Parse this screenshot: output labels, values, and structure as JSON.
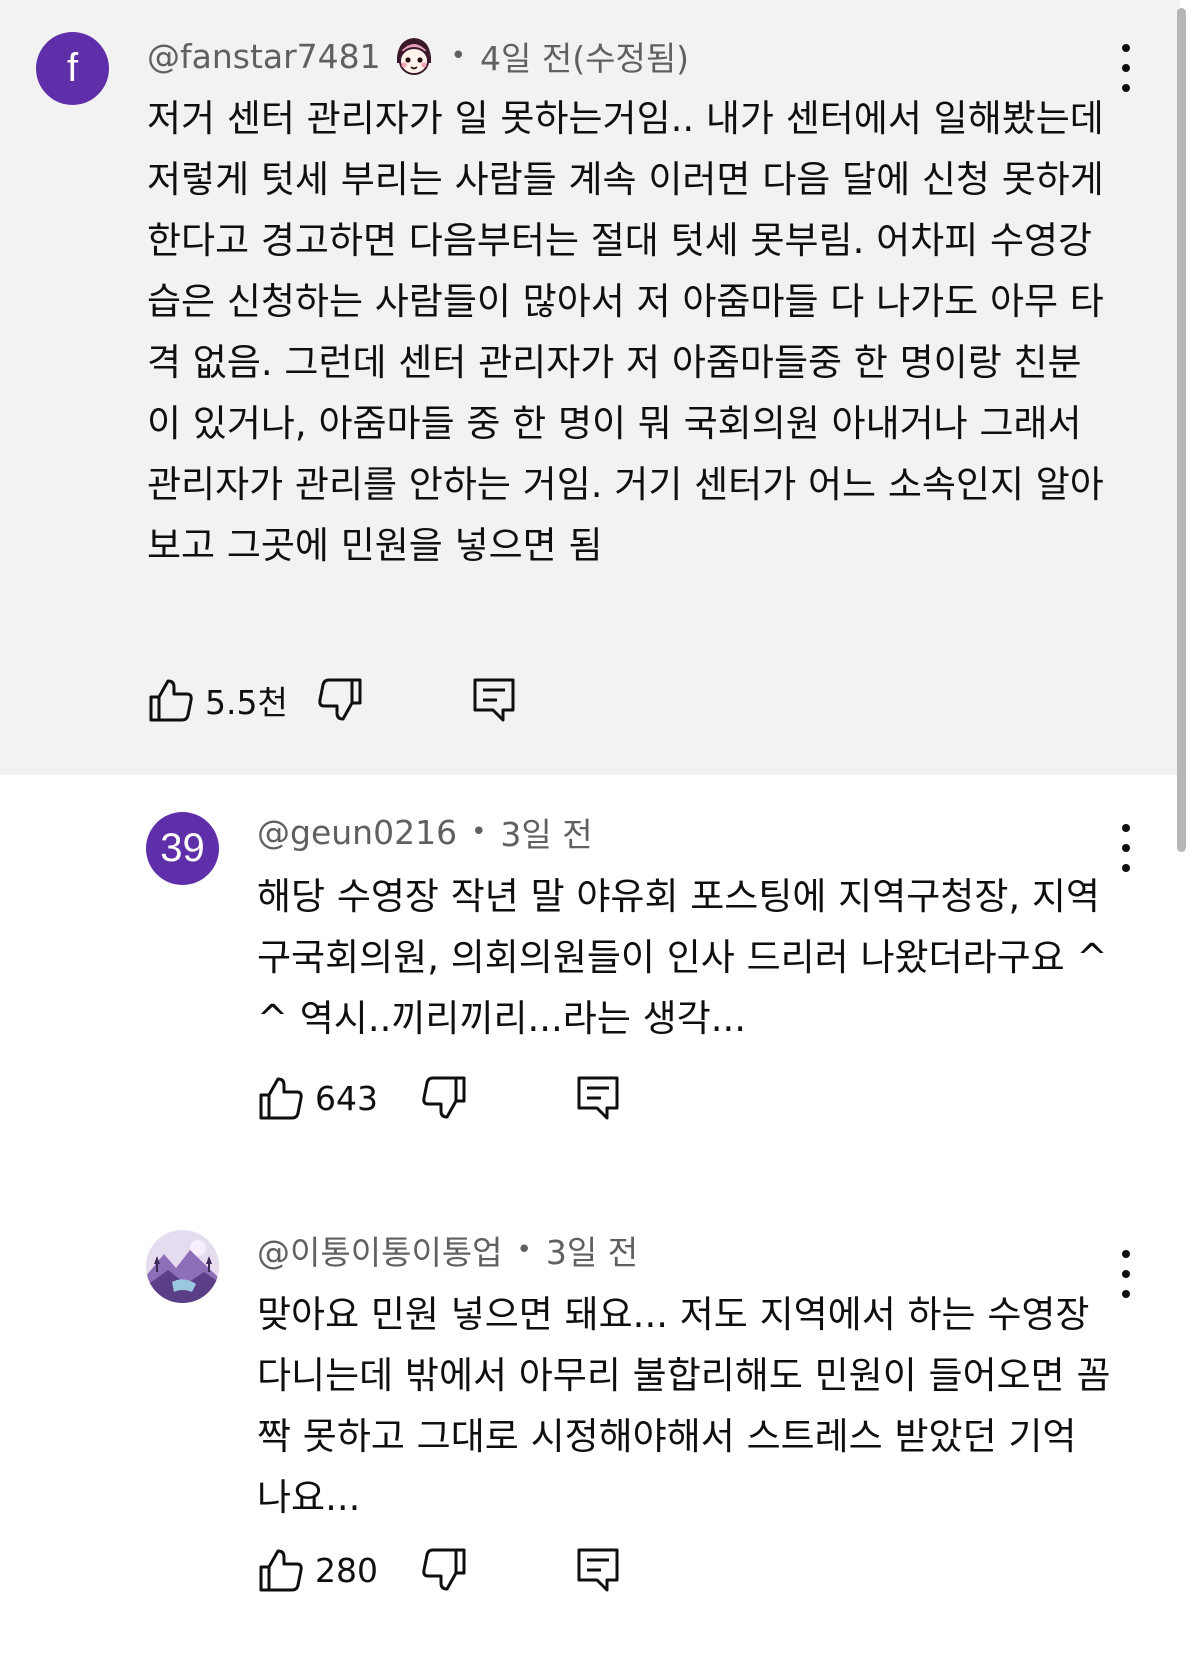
{
  "comments": [
    {
      "avatar_text": "f",
      "avatar_color": "#5e2fa8",
      "handle": "@fanstar7481",
      "time": "4일 전(수정됨)",
      "has_badge": true,
      "badge_icon": "character-face-icon",
      "text": "저거 센터 관리자가 일 못하는거임.. 내가 센터에서 일해봤는데 저렇게 텃세 부리는 사람들 계속 이러면 다음 달에 신청 못하게 한다고 경고하면 다음부터는 절대 텃세 못부림. 어차피 수영강습은 신청하는 사람들이 많아서 저 아줌마들 다 나가도 아무 타격 없음. 그런데 센터 관리자가 저 아줌마들중 한 명이랑 친분이 있거나, 아줌마들 중 한 명이 뭐 국회의원 아내거나 그래서 관리자가 관리를 안하는 거임. 거기 센터가 어느 소속인지 알아 보고 그곳에 민원을 넣으면 됨",
      "likes": "5.5천",
      "highlighted": true
    },
    {
      "avatar_text": "39",
      "avatar_color": "#5e2fa8",
      "handle": "@geun0216",
      "time": "3일 전",
      "has_badge": false,
      "text": "해당 수영장 작년 말 야유회 포스팅에 지역구청장, 지역구국회의원,  의회의원들이 인사 드리러 나왔더라구요 ^^ 역시..끼리끼리...라는 생각...",
      "likes": "643",
      "highlighted": false
    },
    {
      "avatar_text": "",
      "avatar_icon": "landscape-avatar-icon",
      "handle": "@이통이통이통업",
      "time": "3일 전",
      "has_badge": false,
      "text": "맞아요 민원 넣으면 돼요... 저도 지역에서 하는 수영장 다니는데 밖에서 아무리 불합리해도 민원이 들어오면 꼼짝 못하고 그대로 시정해야해서 스트레스 받았던 기억 나요...",
      "likes": "280",
      "highlighted": false
    }
  ],
  "separator": "•",
  "icons": {
    "like": "thumbs-up-icon",
    "dislike": "thumbs-down-icon",
    "reply": "reply-icon",
    "more": "more-vertical-icon"
  },
  "colors": {
    "highlight_bg": "#f2f2f2",
    "avatar_purple": "#5e2fa8",
    "meta_gray": "#606060"
  }
}
